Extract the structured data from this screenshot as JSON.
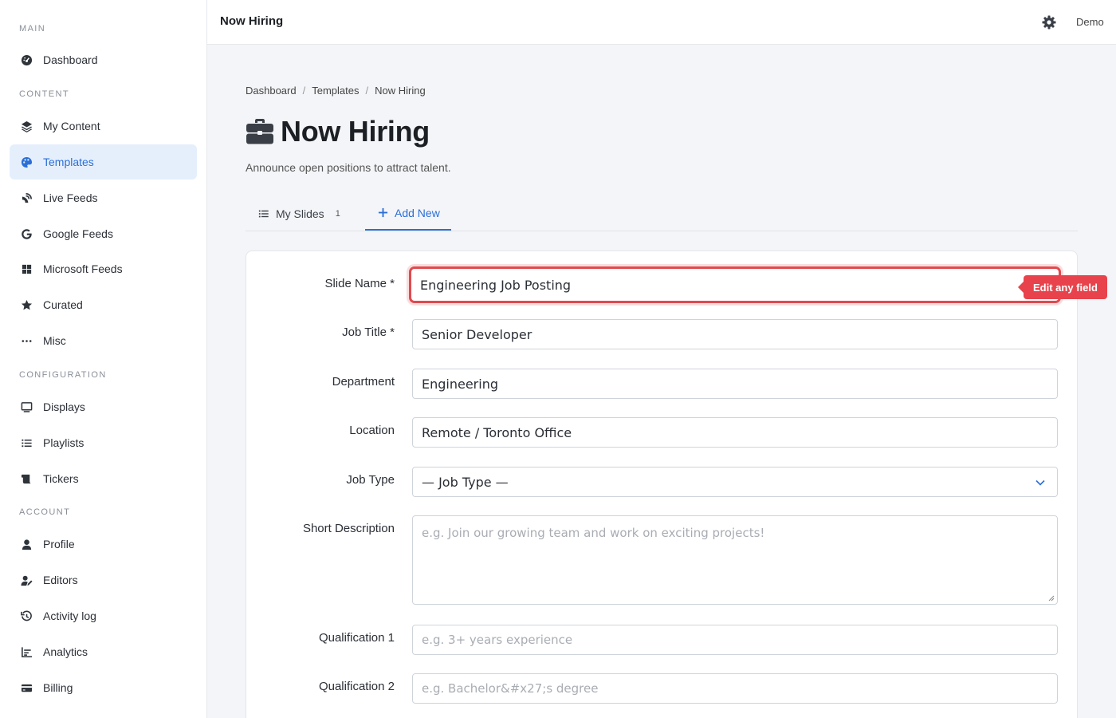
{
  "sidebar": {
    "sections": {
      "main": "MAIN",
      "content": "CONTENT",
      "configuration": "CONFIGURATION",
      "account": "ACCOUNT"
    },
    "items": [
      {
        "label": "Dashboard",
        "icon": "gauge-icon"
      },
      {
        "label": "My Content",
        "icon": "layers-icon"
      },
      {
        "label": "Templates",
        "icon": "palette-icon",
        "active": true
      },
      {
        "label": "Live Feeds",
        "icon": "satellite-dish-icon"
      },
      {
        "label": "Google Feeds",
        "icon": "google-icon"
      },
      {
        "label": "Microsoft Feeds",
        "icon": "windows-icon"
      },
      {
        "label": "Curated",
        "icon": "star-icon"
      },
      {
        "label": "Misc",
        "icon": "ellipsis-icon"
      },
      {
        "label": "Displays",
        "icon": "monitor-icon"
      },
      {
        "label": "Playlists",
        "icon": "list-icon"
      },
      {
        "label": "Tickers",
        "icon": "scroll-icon"
      },
      {
        "label": "Profile",
        "icon": "user-icon"
      },
      {
        "label": "Editors",
        "icon": "user-pen-icon"
      },
      {
        "label": "Activity log",
        "icon": "history-icon"
      },
      {
        "label": "Analytics",
        "icon": "chart-icon"
      },
      {
        "label": "Billing",
        "icon": "credit-card-icon"
      }
    ]
  },
  "topbar": {
    "title": "Now Hiring",
    "user": "Demo",
    "settings_icon": "gear-icon"
  },
  "breadcrumb": [
    "Dashboard",
    "Templates",
    "Now Hiring"
  ],
  "breadcrumb_separator": "/",
  "page": {
    "title": "Now Hiring",
    "title_icon": "briefcase-icon",
    "subtitle": "Announce open positions to attract talent."
  },
  "tabs": {
    "my_slides": {
      "label": "My Slides",
      "count": "1"
    },
    "add_new": {
      "label": "Add New"
    }
  },
  "form": {
    "slide_name": {
      "label": "Slide Name *",
      "value": "Engineering Job Posting"
    },
    "job_title": {
      "label": "Job Title *",
      "value": "Senior Developer"
    },
    "department": {
      "label": "Department",
      "value": "Engineering"
    },
    "location": {
      "label": "Location",
      "value": "Remote / Toronto Office"
    },
    "job_type": {
      "label": "Job Type",
      "value": "— Job Type —"
    },
    "short_description": {
      "label": "Short Description",
      "placeholder": "e.g. Join our growing team and work on exciting projects!"
    },
    "qualification_1": {
      "label": "Qualification 1",
      "placeholder": "e.g. 3+ years experience"
    },
    "qualification_2": {
      "label": "Qualification 2",
      "placeholder": "e.g. Bachelor&#x27;s degree"
    }
  },
  "tooltip": "Edit any field",
  "colors": {
    "accent": "#2b6fd6",
    "active_bg": "#e5effc",
    "highlight": "#e04a4f",
    "tooltip_bg": "#e8434c"
  }
}
